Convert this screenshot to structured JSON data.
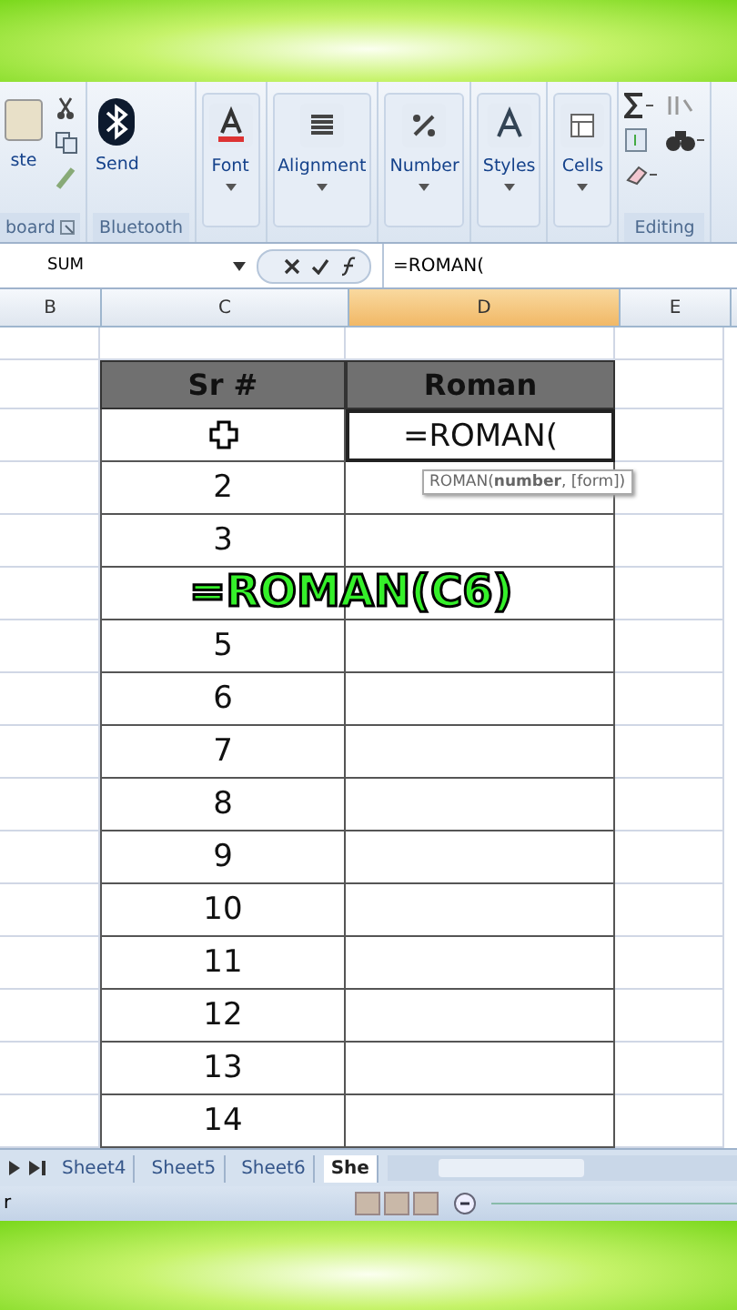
{
  "ribbon": {
    "groups": [
      {
        "kind": "clipboard",
        "label": "board",
        "buttons": [
          {
            "label": "ste"
          }
        ]
      },
      {
        "kind": "group",
        "label": "Bluetooth",
        "buttons": [
          {
            "label": "Send"
          }
        ]
      },
      {
        "kind": "collapsed",
        "buttons": [
          {
            "label": "Font"
          }
        ]
      },
      {
        "kind": "collapsed",
        "buttons": [
          {
            "label": "Alignment"
          }
        ]
      },
      {
        "kind": "collapsed",
        "buttons": [
          {
            "label": "Number"
          }
        ]
      },
      {
        "kind": "collapsed",
        "buttons": [
          {
            "label": "Styles"
          }
        ]
      },
      {
        "kind": "collapsed",
        "buttons": [
          {
            "label": "Cells"
          }
        ]
      },
      {
        "kind": "editing",
        "label": "Editing"
      }
    ]
  },
  "formula_bar": {
    "name_box": "SUM",
    "formula": "=ROMAN("
  },
  "columns": [
    {
      "label": "B",
      "selected": false
    },
    {
      "label": "C",
      "selected": false
    },
    {
      "label": "D",
      "selected": true
    },
    {
      "label": "E",
      "selected": false
    }
  ],
  "table": {
    "header": [
      "Sr #",
      "Roman"
    ],
    "rows": [
      {
        "cursor": true,
        "editing": true,
        "roman": "=ROMAN("
      },
      {
        "sr": "2",
        "cursor": false,
        "editing": false
      },
      {
        "sr": "3",
        "cursor": false,
        "editing": false
      },
      {
        "cursor": false,
        "editing": false
      },
      {
        "sr": "5",
        "cursor": false,
        "editing": false
      },
      {
        "sr": "6",
        "cursor": false,
        "editing": false
      },
      {
        "sr": "7",
        "cursor": false,
        "editing": false
      },
      {
        "sr": "8",
        "cursor": false,
        "editing": false
      },
      {
        "sr": "9",
        "cursor": false,
        "editing": false
      },
      {
        "sr": "10",
        "cursor": false,
        "editing": false
      },
      {
        "sr": "11",
        "cursor": false,
        "editing": false
      },
      {
        "sr": "12",
        "cursor": false,
        "editing": false
      },
      {
        "sr": "13",
        "cursor": false,
        "editing": false
      },
      {
        "sr": "14",
        "cursor": false,
        "editing": false
      }
    ]
  },
  "tooltip": "ROMAN(**number**, [form])",
  "caption": "=ROMAN(C6)",
  "sheet_tabs": [
    {
      "label": "Sheet4",
      "selected": false
    },
    {
      "label": "Sheet5",
      "selected": false
    },
    {
      "label": "Sheet6",
      "selected": false
    },
    {
      "label": "She",
      "selected": true
    }
  ],
  "status_bar": {
    "text": "r"
  }
}
